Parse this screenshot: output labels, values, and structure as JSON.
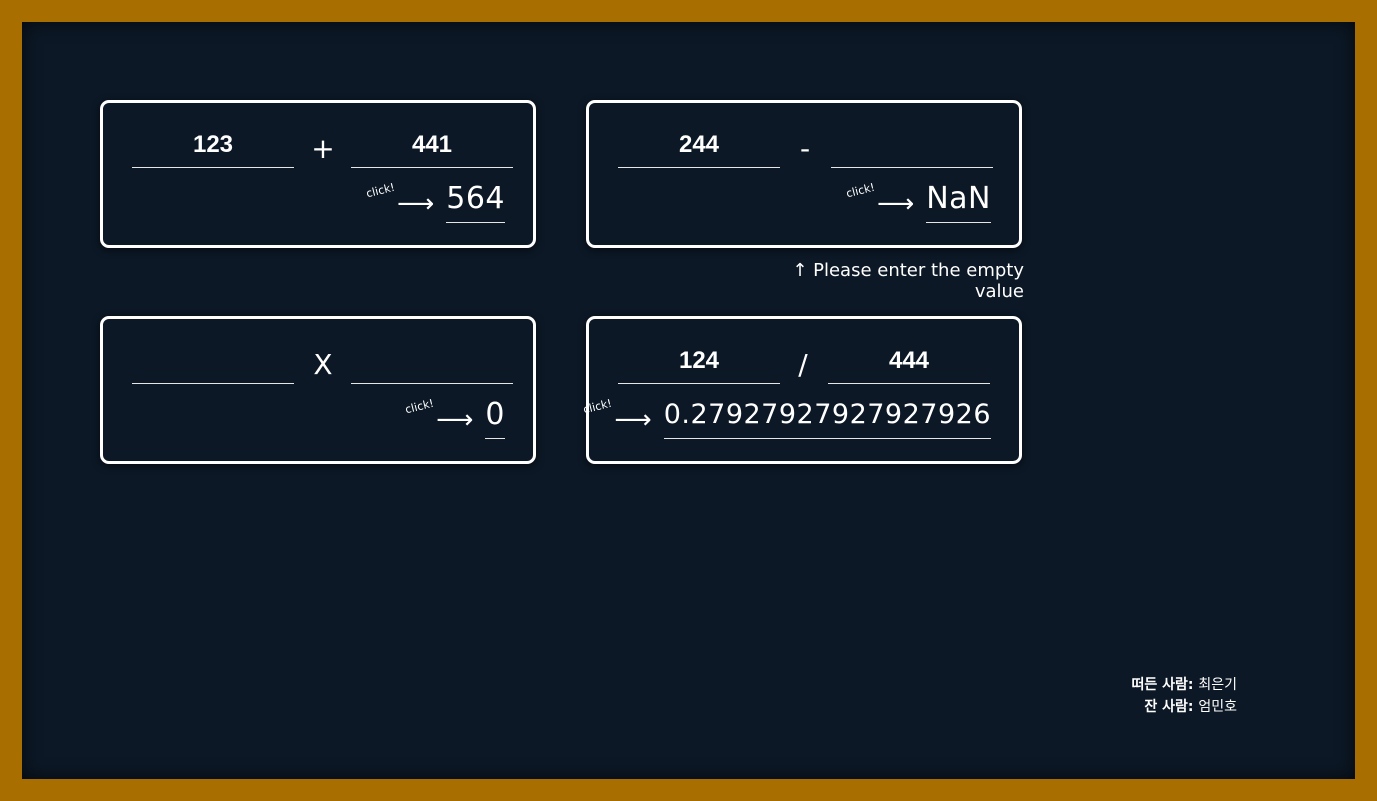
{
  "addition": {
    "left_value": "123",
    "operator": "+",
    "right_value": "441",
    "click_label": "click!",
    "arrow": "⟶",
    "result": "564"
  },
  "subtraction": {
    "left_value": "244",
    "operator": "-",
    "right_value": "",
    "click_label": "click!",
    "arrow": "⟶",
    "result": "NaN",
    "hint": "↑ Please enter the empty value"
  },
  "multiplication": {
    "left_value": "",
    "operator": "X",
    "right_value": "",
    "click_label": "click!",
    "arrow": "⟶",
    "result": "0"
  },
  "division": {
    "left_value": "124",
    "operator": "/",
    "right_value": "444",
    "click_label": "click!",
    "arrow": "⟶",
    "result": "0.27927927927927926"
  },
  "credits": {
    "line1_label": "떠든 사람:",
    "line1_name": "최은기",
    "line2_label": "잔 사람:",
    "line2_name": "엄민호"
  },
  "colors": {
    "frame": "#a86f00",
    "board": "#0c1826",
    "chalk": "#ffffff"
  }
}
